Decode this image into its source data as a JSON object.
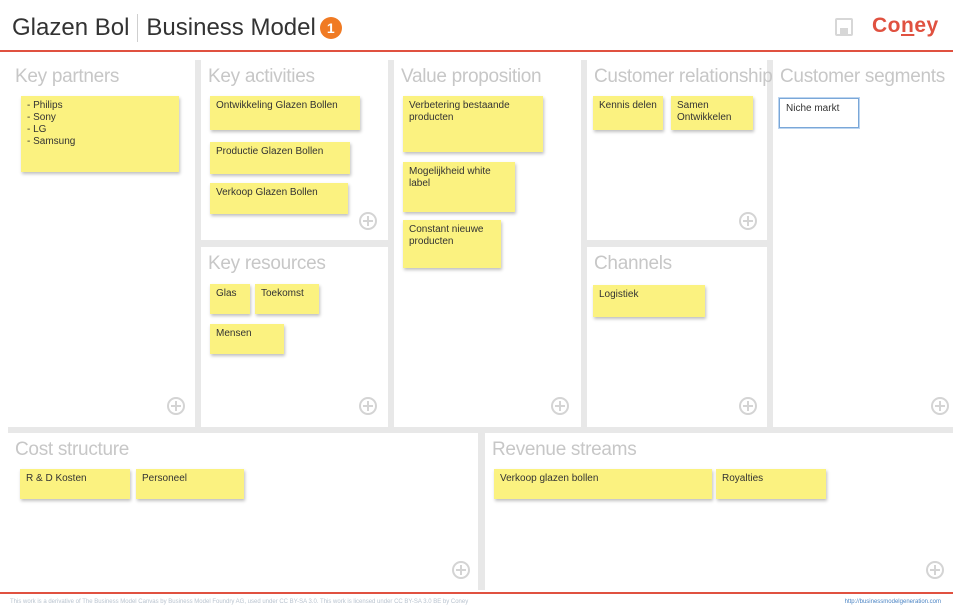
{
  "header": {
    "project_title": "Glazen Bol",
    "page_title": "Business Model",
    "badge_count": "1",
    "logo_text_pre": "Co",
    "logo_text_u": "n",
    "logo_text_post": "ey",
    "accent_color": "#e05140",
    "badge_color": "#f07a23"
  },
  "blocks": {
    "key_partners": "Key partners",
    "key_activities": "Key activities",
    "value_proposition": "Value proposition",
    "customer_relationships": "Customer relationships",
    "customer_segments": "Customer segments",
    "key_resources": "Key resources",
    "channels": "Channels",
    "cost_structure": "Cost structure",
    "revenue_streams": "Revenue streams"
  },
  "notes": {
    "key_partners": [
      "- Philips\n- Sony\n- LG\n- Samsung"
    ],
    "key_activities": [
      "Ontwikkeling Glazen Bollen",
      "Productie Glazen Bollen",
      "Verkoop Glazen Bollen"
    ],
    "value_proposition": [
      "Verbetering bestaande producten",
      "Mogelijkheid white label",
      "Constant nieuwe producten"
    ],
    "customer_relationships": [
      "Kennis delen",
      "Samen Ontwikkelen"
    ],
    "customer_segments": [
      "Niche markt"
    ],
    "key_resources": [
      "Glas",
      "Toekomst",
      "Mensen"
    ],
    "channels": [
      "Logistiek"
    ],
    "cost_structure": [
      "R & D Kosten",
      "Personeel"
    ],
    "revenue_streams": [
      "Verkoop glazen bollen",
      "Royalties"
    ]
  },
  "footer": {
    "license_text": "This work is a derivative of The Business Model Canvas by Business Model Foundry AG, used under CC BY-SA 3.0. This work is licensed under CC BY-SA 3.0 BE by Coney",
    "link_text": "http://businessmodelgeneration.com"
  }
}
